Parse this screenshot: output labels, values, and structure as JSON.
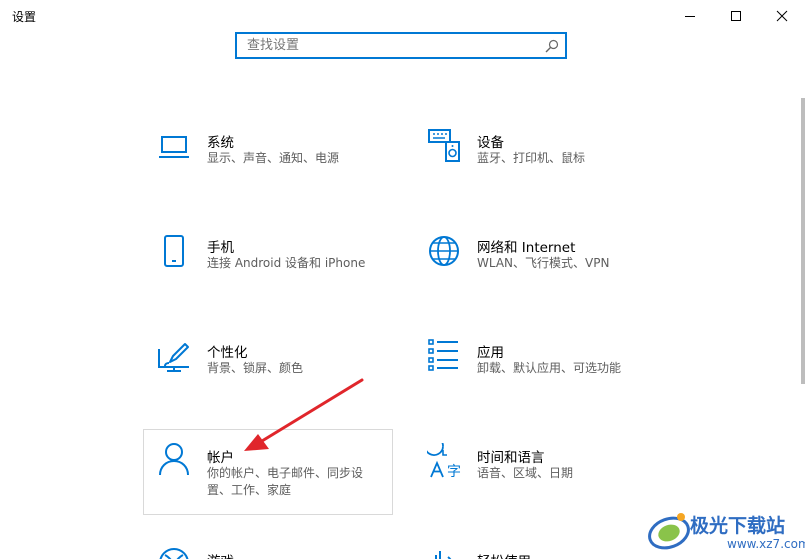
{
  "window": {
    "title": "设置",
    "minimize_label": "—",
    "maximize_label": "□",
    "close_label": "✕"
  },
  "search": {
    "placeholder": "查找设置",
    "value": ""
  },
  "categories": [
    {
      "id": "system",
      "title": "系统",
      "desc": "显示、声音、通知、电源",
      "icon": "laptop-icon"
    },
    {
      "id": "devices",
      "title": "设备",
      "desc": "蓝牙、打印机、鼠标",
      "icon": "keyboard-speaker-icon"
    },
    {
      "id": "phone",
      "title": "手机",
      "desc": "连接 Android 设备和 iPhone",
      "icon": "phone-icon"
    },
    {
      "id": "network",
      "title": "网络和 Internet",
      "desc": "WLAN、飞行模式、VPN",
      "icon": "globe-icon"
    },
    {
      "id": "personalization",
      "title": "个性化",
      "desc": "背景、锁屏、颜色",
      "icon": "paint-brush-icon"
    },
    {
      "id": "apps",
      "title": "应用",
      "desc": "卸载、默认应用、可选功能",
      "icon": "app-list-icon"
    },
    {
      "id": "accounts",
      "title": "帐户",
      "desc": "你的帐户、电子邮件、同步设置、工作、家庭",
      "icon": "person-icon"
    },
    {
      "id": "time-language",
      "title": "时间和语言",
      "desc": "语音、区域、日期",
      "icon": "time-language-icon"
    },
    {
      "id": "gaming",
      "title": "游戏",
      "desc": "",
      "icon": "xbox-icon"
    },
    {
      "id": "ease-of-access",
      "title": "轻松使用",
      "desc": "",
      "icon": "ease-of-access-icon"
    }
  ],
  "watermark": {
    "text": "极光下载站",
    "url": "www.xz7.com"
  },
  "colors": {
    "accent": "#0078d4",
    "arrow": "#e0262b",
    "watermark": "#2f6dc2"
  }
}
